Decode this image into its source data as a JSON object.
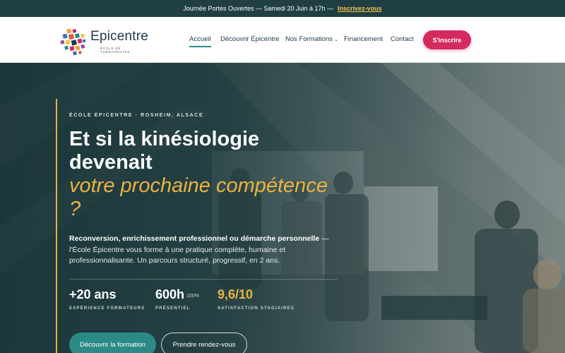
{
  "announcement": {
    "text": "Journée Portes Ouvertes — Samedi 20 Juin à 17h —",
    "link": "Inscrivez-vous"
  },
  "header": {
    "logo_name": "Epicentre",
    "logo_tagline": "ÉCOLE DE THÉRAPEUTES",
    "nav": [
      {
        "label": "Accueil",
        "active": true
      },
      {
        "label": "Découvrir Épicentre"
      },
      {
        "label": "Nos Formations",
        "caret": "⌄"
      },
      {
        "label": "Financement"
      },
      {
        "label": "Contact"
      }
    ],
    "cta": "S'inscrire"
  },
  "hero": {
    "eyebrow": "ÉCOLE ÉPICENTRE · ROSHEIM, ALSACE",
    "title_line1": "Et si la kinésiologie devenait",
    "title_accent": "votre prochaine compétence ?",
    "lead_strong": "Reconversion, enrichissement professionnel ou démarche personnelle",
    "lead_rest": " — l'École Épicentre vous forme à une pratique complète, humaine et professionnalisante. Un parcours structuré, progressif, en 2 ans.",
    "stats": [
      {
        "value": "+20 ans",
        "label": "EXPÉRIENCE FORMATEURS"
      },
      {
        "value": "600h",
        "sup": "100%",
        "label": "PRÉSENTIEL"
      },
      {
        "value": "9,6/10",
        "label": "SATISFACTION STAGIAIRES"
      }
    ],
    "btn_primary": "Découvrir la formation",
    "btn_secondary": "Prendre rendez-vous"
  },
  "colors": {
    "announce_bg": "#1f3f44",
    "accent_gold": "#e8b43f",
    "brand_pink": "#d42a5e",
    "brand_teal": "#2c8a86"
  }
}
